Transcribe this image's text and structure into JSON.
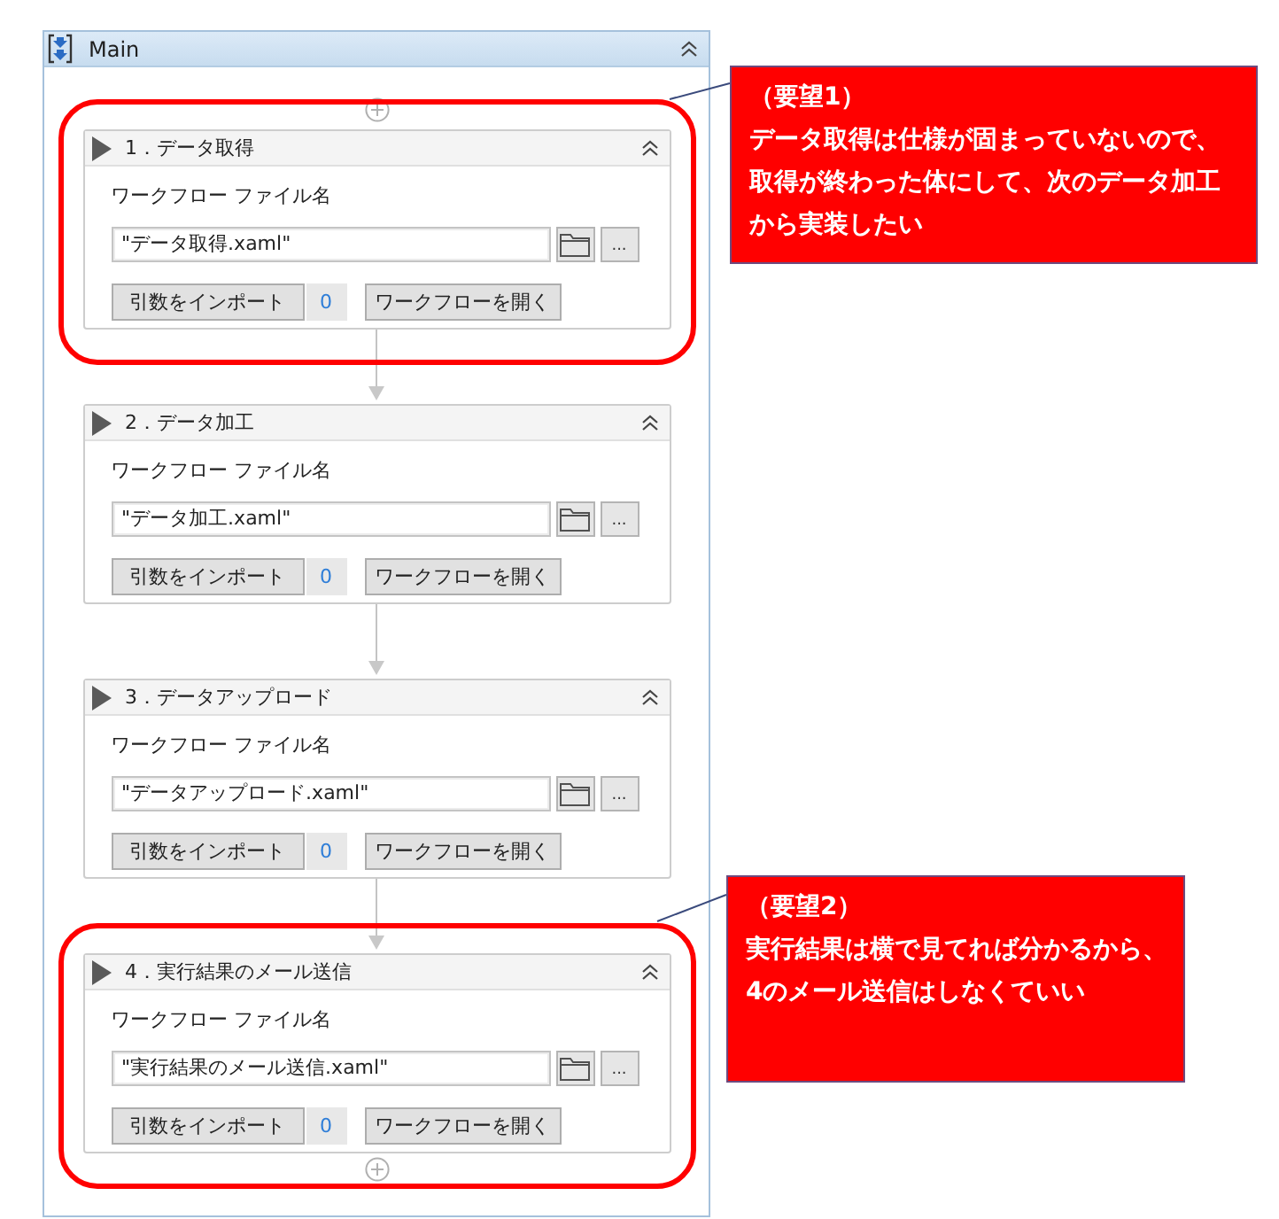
{
  "window": {
    "title": "Main"
  },
  "activities": [
    {
      "title": "1．データ取得",
      "highlighted": true,
      "field_label": "ワークフロー ファイル名",
      "file_name": "\"データ取得.xaml\"",
      "browse_button": "...",
      "import_button": "引数をインポート",
      "argument_count": "0",
      "open_button": "ワークフローを開く"
    },
    {
      "title": "2．データ加工",
      "highlighted": false,
      "field_label": "ワークフロー ファイル名",
      "file_name": "\"データ加工.xaml\"",
      "browse_button": "...",
      "import_button": "引数をインポート",
      "argument_count": "0",
      "open_button": "ワークフローを開く"
    },
    {
      "title": "3．データアップロード",
      "highlighted": false,
      "field_label": "ワークフロー ファイル名",
      "file_name": "\"データアップロード.xaml\"",
      "browse_button": "...",
      "import_button": "引数をインポート",
      "argument_count": "0",
      "open_button": "ワークフローを開く"
    },
    {
      "title": "4．実行結果のメール送信",
      "highlighted": true,
      "field_label": "ワークフロー ファイル名",
      "file_name": "\"実行結果のメール送信.xaml\"",
      "browse_button": "...",
      "import_button": "引数をインポート",
      "argument_count": "0",
      "open_button": "ワークフローを開く"
    }
  ],
  "annotations": [
    {
      "title": "（要望1）",
      "text": "データ取得は仕様が固まっていないので、取得が終わった体にして、次のデータ加工から実装したい"
    },
    {
      "title": "（要望2）",
      "text": "実行結果は横で見てれば分かるから、4のメール送信はしなくていい"
    }
  ]
}
